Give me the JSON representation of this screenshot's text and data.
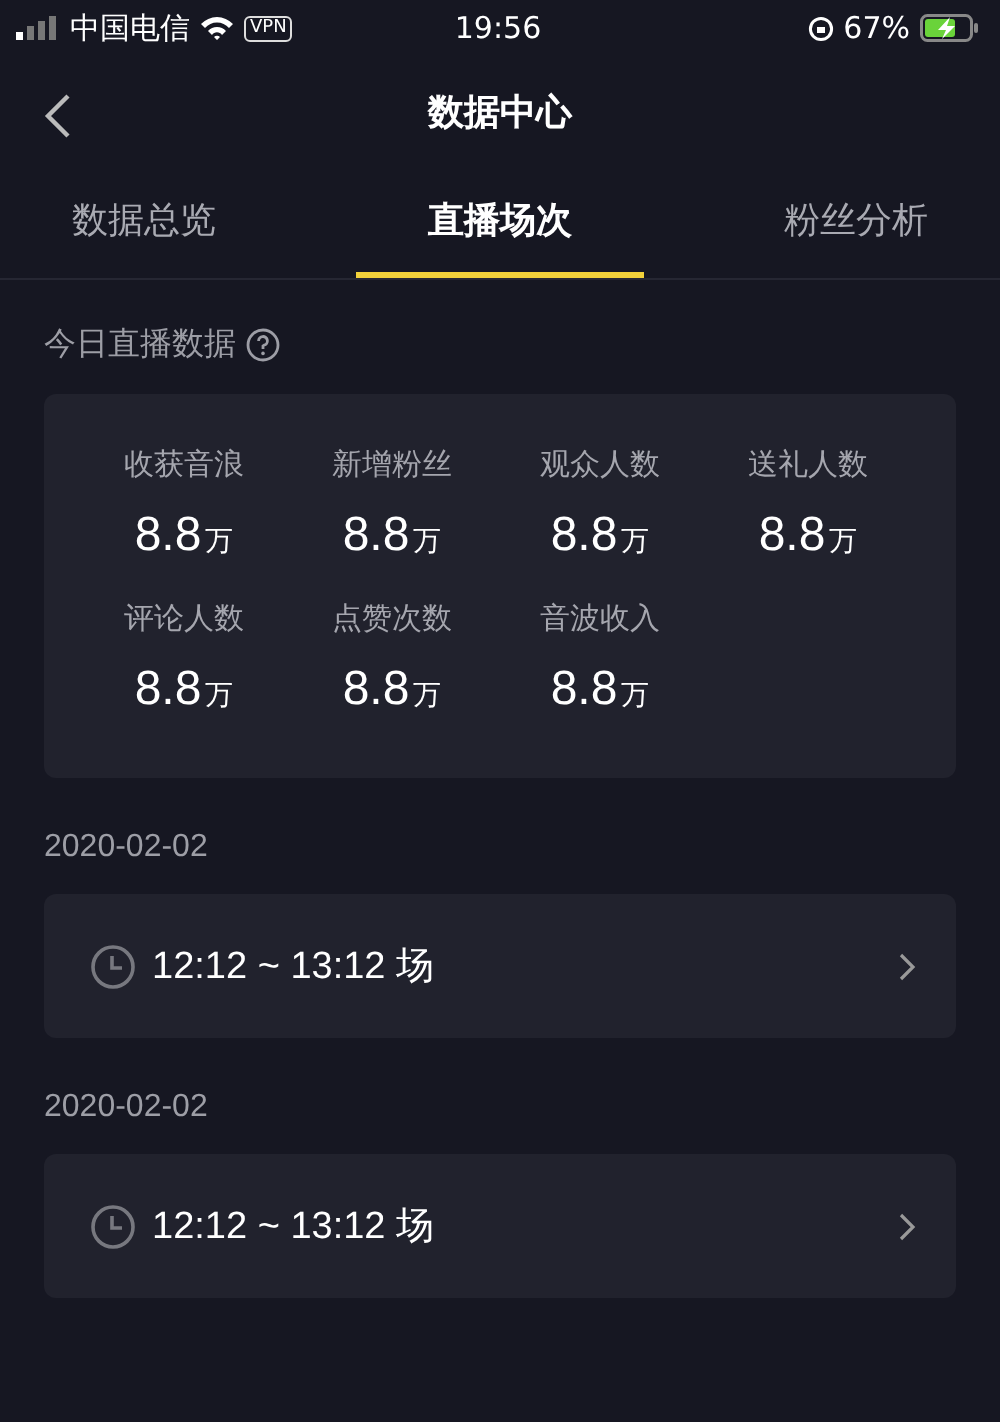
{
  "status_bar": {
    "carrier": "中国电信",
    "vpn": "VPN",
    "time": "19:56",
    "battery": "67%"
  },
  "nav": {
    "title": "数据中心"
  },
  "tabs": [
    {
      "label": "数据总览",
      "selected": false
    },
    {
      "label": "直播场次",
      "selected": true
    },
    {
      "label": "粉丝分析",
      "selected": false
    }
  ],
  "today": {
    "title": "今日直播数据",
    "stats": [
      {
        "label": "收获音浪",
        "value": "8.8",
        "unit": "万"
      },
      {
        "label": "新增粉丝",
        "value": "8.8",
        "unit": "万"
      },
      {
        "label": "观众人数",
        "value": "8.8",
        "unit": "万"
      },
      {
        "label": "送礼人数",
        "value": "8.8",
        "unit": "万"
      },
      {
        "label": "评论人数",
        "value": "8.8",
        "unit": "万"
      },
      {
        "label": "点赞次数",
        "value": "8.8",
        "unit": "万"
      },
      {
        "label": "音波收入",
        "value": "8.8",
        "unit": "万"
      }
    ]
  },
  "sessions": [
    {
      "date": "2020-02-02",
      "time": "12:12 ~ 13:12 场"
    },
    {
      "date": "2020-02-02",
      "time": "12:12 ~ 13:12 场"
    }
  ]
}
